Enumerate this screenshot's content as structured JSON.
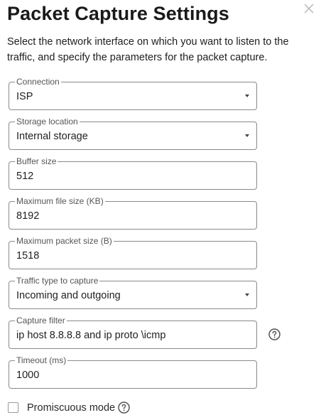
{
  "dialog": {
    "title": "Packet Capture Settings",
    "description": "Select the network interface on which you want to listen to the traffic, and specify the parameters for the packet capture.",
    "close_icon": "close-icon"
  },
  "fields": {
    "connection": {
      "label": "Connection",
      "value": "ISP"
    },
    "storage": {
      "label": "Storage location",
      "value": "Internal storage"
    },
    "buffer": {
      "label": "Buffer size",
      "value": "512"
    },
    "max_file": {
      "label": "Maximum file size (KB)",
      "value": "8192"
    },
    "max_packet": {
      "label": "Maximum packet size (B)",
      "value": "1518"
    },
    "traffic_type": {
      "label": "Traffic type to capture",
      "value": "Incoming and outgoing"
    },
    "capture_filter": {
      "label": "Capture filter",
      "value": "ip host 8.8.8.8 and ip proto \\icmp"
    },
    "timeout": {
      "label": "Timeout (ms)",
      "value": "1000"
    }
  },
  "promiscuous": {
    "label": "Promiscuous mode",
    "checked": false
  },
  "colors": {
    "border": "#8a8a8a",
    "label": "#555555",
    "text": "#1f1f1f"
  }
}
